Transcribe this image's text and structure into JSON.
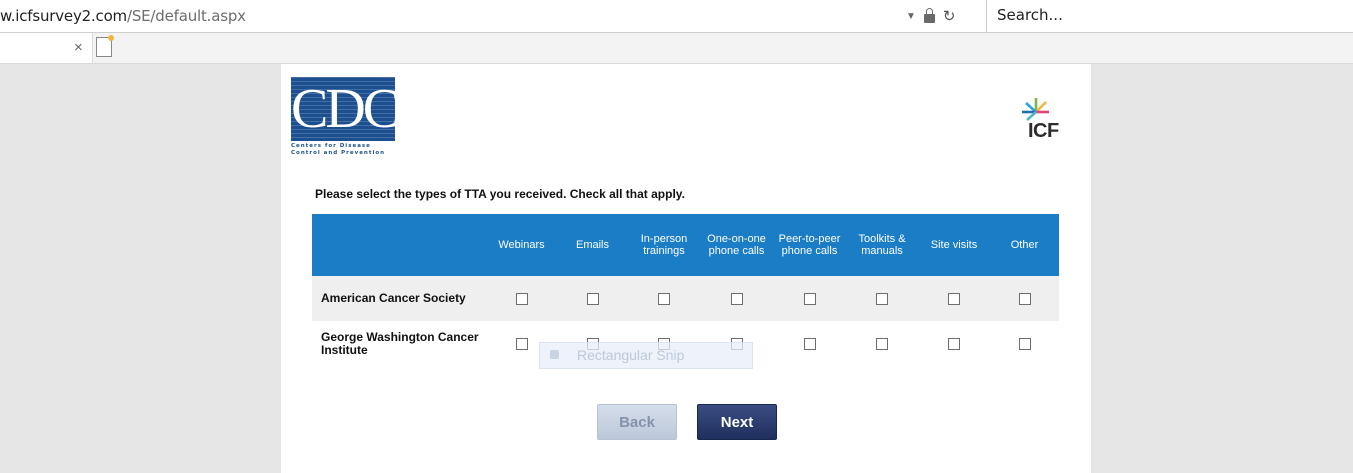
{
  "browser": {
    "url_prefix": "w.icfsurvey2.com",
    "url_path": "/SE/default.aspx",
    "search_placeholder": "Search...",
    "tab_close": "×"
  },
  "logos": {
    "cdc_letters": "CDC",
    "cdc_tagline_1": "Centers for Disease",
    "cdc_tagline_2": "Control and Prevention",
    "icf": "ICF"
  },
  "survey": {
    "question": "Please select the types of TTA you received. Check all that apply.",
    "columns": [
      "Webinars",
      "Emails",
      "In-person trainings",
      "One-on-one phone calls",
      "Peer-to-peer phone calls",
      "Toolkits & manuals",
      "Site visits",
      "Other"
    ],
    "rows": [
      {
        "label": "American Cancer Society",
        "checked": [
          false,
          false,
          false,
          false,
          false,
          false,
          false,
          false
        ]
      },
      {
        "label": "George Washington Cancer Institute",
        "checked": [
          false,
          false,
          false,
          false,
          false,
          false,
          false,
          false
        ]
      }
    ]
  },
  "buttons": {
    "back": "Back",
    "next": "Next"
  },
  "overlay": {
    "snip_label": "Rectangular Snip"
  },
  "colors": {
    "header_blue": "#1a7dc6",
    "next_button": "#2a3a6c",
    "back_button": "#c8d2e2",
    "cdc_blue": "#1c4f8f"
  }
}
